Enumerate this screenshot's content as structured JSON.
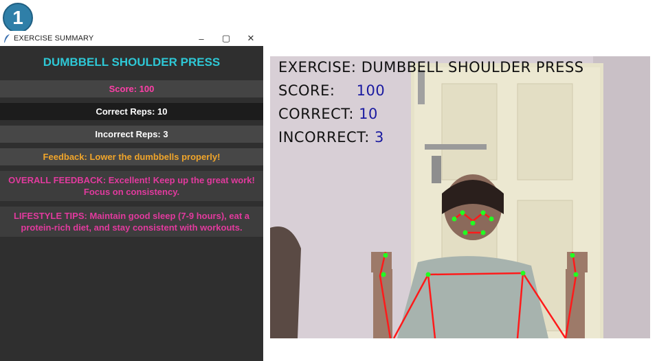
{
  "badge": "1",
  "window": {
    "title": "EXERCISE SUMMARY",
    "minimize": "–",
    "maximize": "▢",
    "close": "✕"
  },
  "summary": {
    "title": "DUMBBELL SHOULDER PRESS",
    "score": "Score: 100",
    "correct": "Correct Reps: 10",
    "incorrect": "Incorrect Reps: 3",
    "feedback": "Feedback: Lower the dumbbells properly!",
    "overall": "OVERALL FEEDBACK: Excellent! Keep up the great work! Focus on consistency.",
    "lifestyle": "LIFESTYLE TIPS: Maintain good sleep (7-9 hours), eat a protein-rich diet, and stay consistent with workouts."
  },
  "hud": {
    "exercise_label": "EXERCISE:",
    "exercise_value": "DUMBBELL SHOULDER PRESS",
    "score_label": "SCORE:",
    "score_value": "100",
    "correct_label": "CORRECT:",
    "correct_value": "10",
    "incorrect_label": "INCORRECT:",
    "incorrect_value": "3"
  },
  "colors": {
    "accent_title": "#2ec8d6",
    "score": "#ff3fa8",
    "feedback": "#f1a52a",
    "tips": "#e23a9e",
    "skeleton": "#ff1a1a",
    "joints": "#22ff22"
  }
}
